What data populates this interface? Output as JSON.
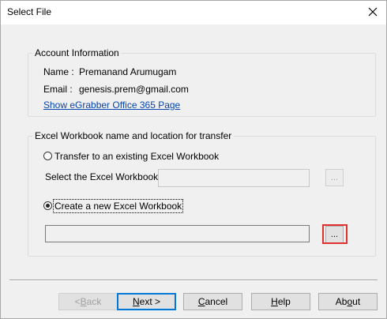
{
  "window": {
    "title": "Select File"
  },
  "account": {
    "legend": "Account Information",
    "name_label": "Name :",
    "name_value": "Premanand Arumugam",
    "email_label": "Email :",
    "email_value": "genesis.prem@gmail.com",
    "link": "Show eGrabber Office 365 Page"
  },
  "workbook": {
    "legend": "Excel Workbook name and location for transfer",
    "option_existing": "Transfer to an existing Excel Workbook",
    "select_label": "Select the Excel Workbook",
    "existing_value": "",
    "option_new": "Create a new Excel Workbook",
    "new_value": "",
    "browse_label": "...",
    "selected_option": "Create a new Excel Workbook"
  },
  "buttons": {
    "back_prefix": "< ",
    "back_key": "B",
    "back_rest": "ack",
    "next_key": "N",
    "next_rest": "ext >",
    "cancel_key": "C",
    "cancel_rest": "ancel",
    "help_key": "H",
    "help_rest": "elp",
    "about_prefix": "Ab",
    "about_key": "o",
    "about_rest": "ut"
  },
  "colors": {
    "highlight": "#e03030",
    "link": "#0645ad",
    "default_button_border": "#0078d7"
  }
}
